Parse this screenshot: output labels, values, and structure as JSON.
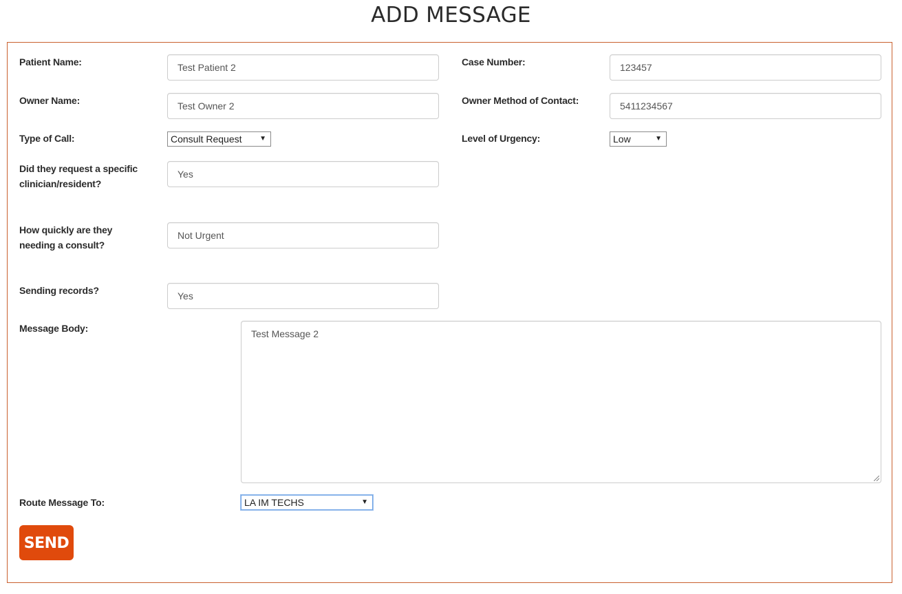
{
  "page": {
    "title": "ADD MESSAGE"
  },
  "form": {
    "patient_name": {
      "label": "Patient Name:",
      "value": "Test Patient 2"
    },
    "case_number": {
      "label": "Case Number:",
      "value": "123457"
    },
    "owner_name": {
      "label": "Owner Name:",
      "value": "Test Owner 2"
    },
    "owner_contact": {
      "label": "Owner Method of Contact:",
      "value": "5411234567"
    },
    "type_of_call": {
      "label": "Type of Call:",
      "selected": "Consult Request"
    },
    "urgency": {
      "label": "Level of Urgency:",
      "selected": "Low"
    },
    "specific_clinician": {
      "label_line1": "Did they request a specific",
      "label_line2": "clinician/resident?",
      "value": "Yes"
    },
    "consult_speed": {
      "label_line1": "How quickly are they",
      "label_line2": "needing a consult?",
      "value": "Not Urgent"
    },
    "sending_records": {
      "label": "Sending records?",
      "value": "Yes"
    },
    "message_body": {
      "label": "Message Body:",
      "value": "Test Message 2"
    },
    "route_to": {
      "label": "Route Message To:",
      "selected": "LA IM TECHS"
    },
    "send_label": "SEND"
  },
  "icons": {
    "dropdown_arrow": "▼"
  },
  "colors": {
    "accent": "#e04a0c",
    "panel_border": "#c9602e"
  }
}
